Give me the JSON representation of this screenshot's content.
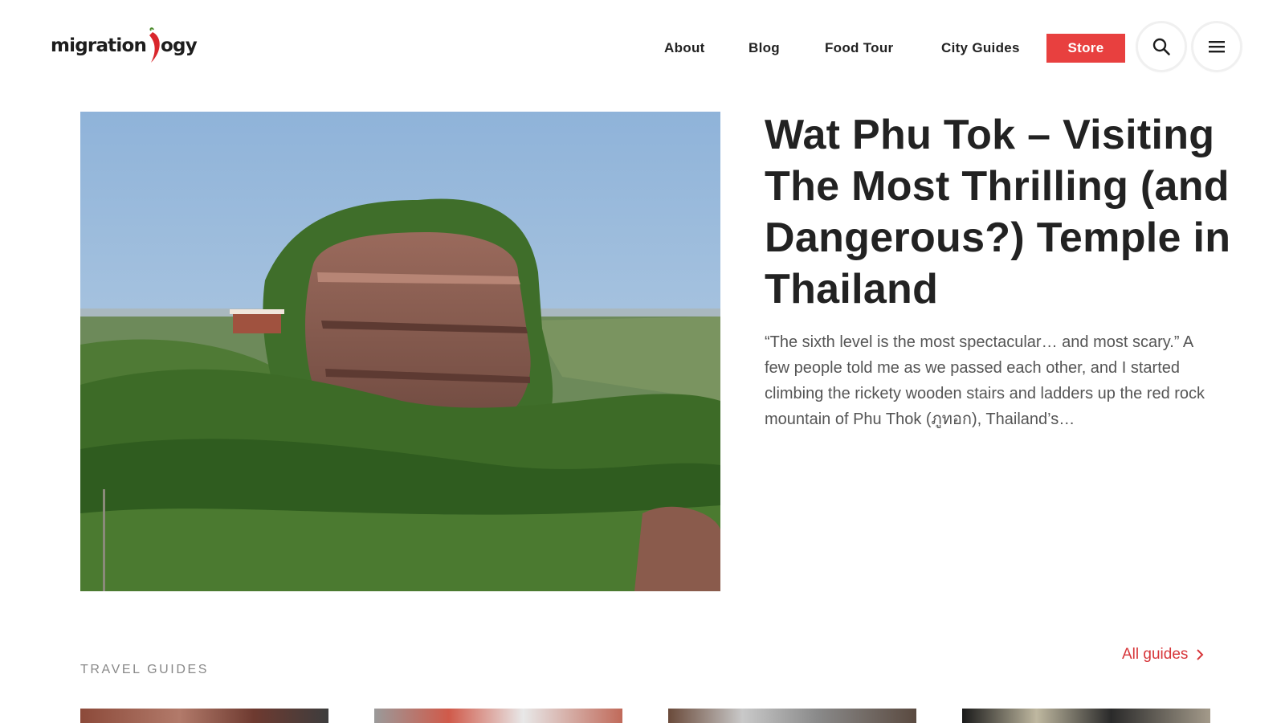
{
  "header": {
    "logo_text_left": "migration",
    "logo_text_right": "ogy",
    "logo_text_mid": "o",
    "nav": {
      "about": "About",
      "blog": "Blog",
      "food_tour": "Food Tour",
      "city_guides": "City Guides",
      "store": "Store"
    },
    "store_color": "#e8403f"
  },
  "featured": {
    "title": "Wat Phu Tok – Visiting The Most Thrilling (and Dangerous?) Temple in Thailand",
    "excerpt": "“The sixth level is the most spectacular… and most scary.” A few people told me as we passed each other, and I started climbing the rickety wooden stairs and ladders up the red rock mountain of Phu Thok (ภูทอก), Thailand’s…"
  },
  "guides": {
    "section_label": "TRAVEL GUIDES",
    "all_link": "All guides",
    "accent_color": "#d7363a"
  }
}
